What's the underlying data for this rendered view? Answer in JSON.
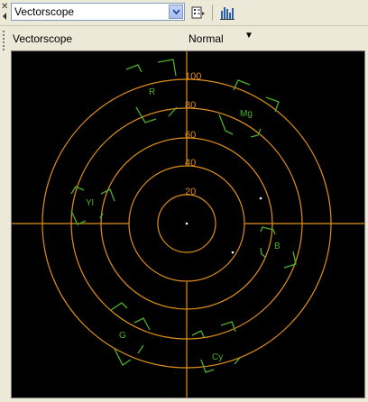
{
  "toolbar": {
    "scope_selector_value": "Vectorscope",
    "icons": [
      "dropdown-arrow-icon",
      "settings-icon",
      "histogram-icon"
    ]
  },
  "subbar": {
    "title": "Vectorscope",
    "mode": "Normal"
  },
  "scope": {
    "ring_labels": [
      "100",
      "80",
      "60",
      "40",
      "20"
    ],
    "targets": [
      "R",
      "Mg",
      "B",
      "Cy",
      "G",
      "Yl"
    ],
    "colors": {
      "background": "#000000",
      "graticule": "#e0901a",
      "targets": "#4caf2a",
      "trace": "#ffffff"
    }
  }
}
